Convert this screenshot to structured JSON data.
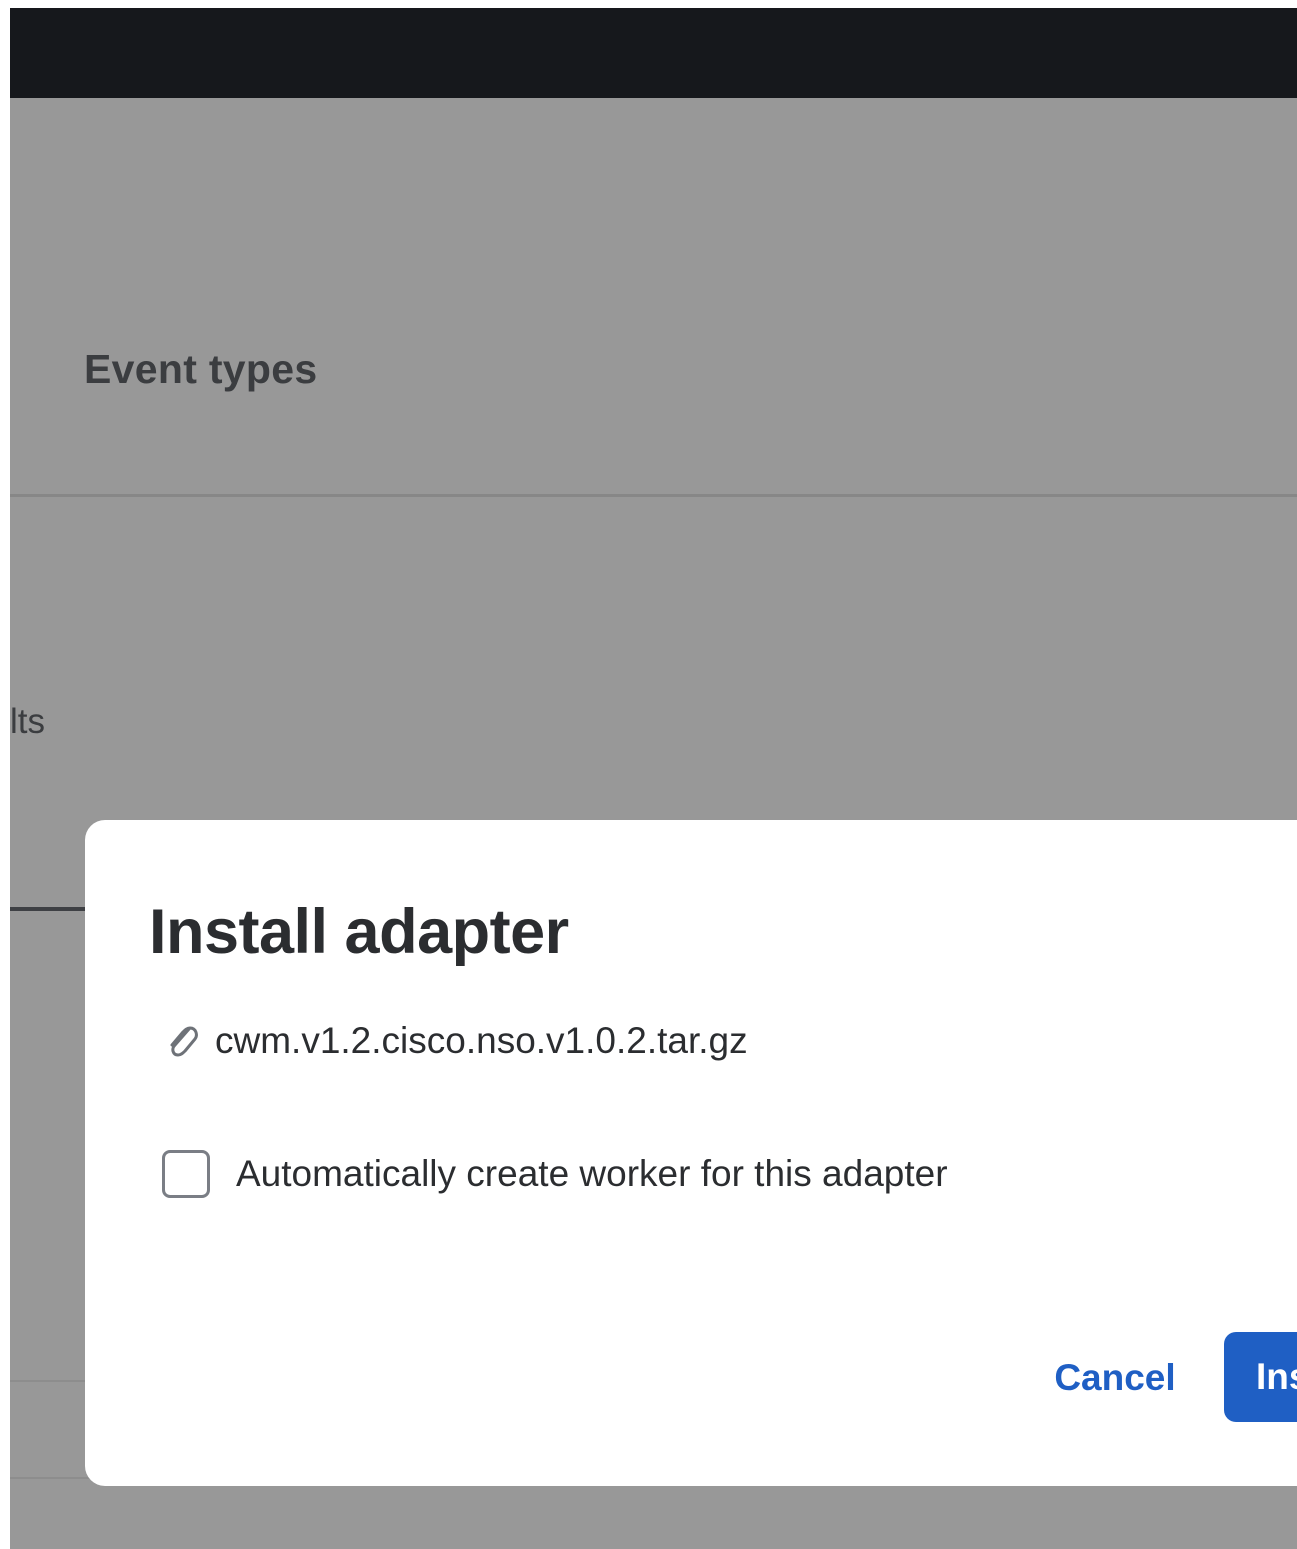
{
  "background": {
    "heading": "Event types",
    "partial_tab_text": "lts"
  },
  "modal": {
    "title": "Install adapter",
    "file_icon": "paperclip-icon",
    "file_name": "cwm.v1.2.cisco.nso.v1.0.2.tar.gz",
    "auto_create_worker": {
      "label": "Automatically create worker for this adapter",
      "checked": false
    },
    "cancel_label": "Cancel",
    "install_label": "Ins"
  },
  "colors": {
    "primary": "#1f5fc4",
    "topbar": "#16181c",
    "backdrop": "#989898",
    "text": "#2b2d30"
  }
}
